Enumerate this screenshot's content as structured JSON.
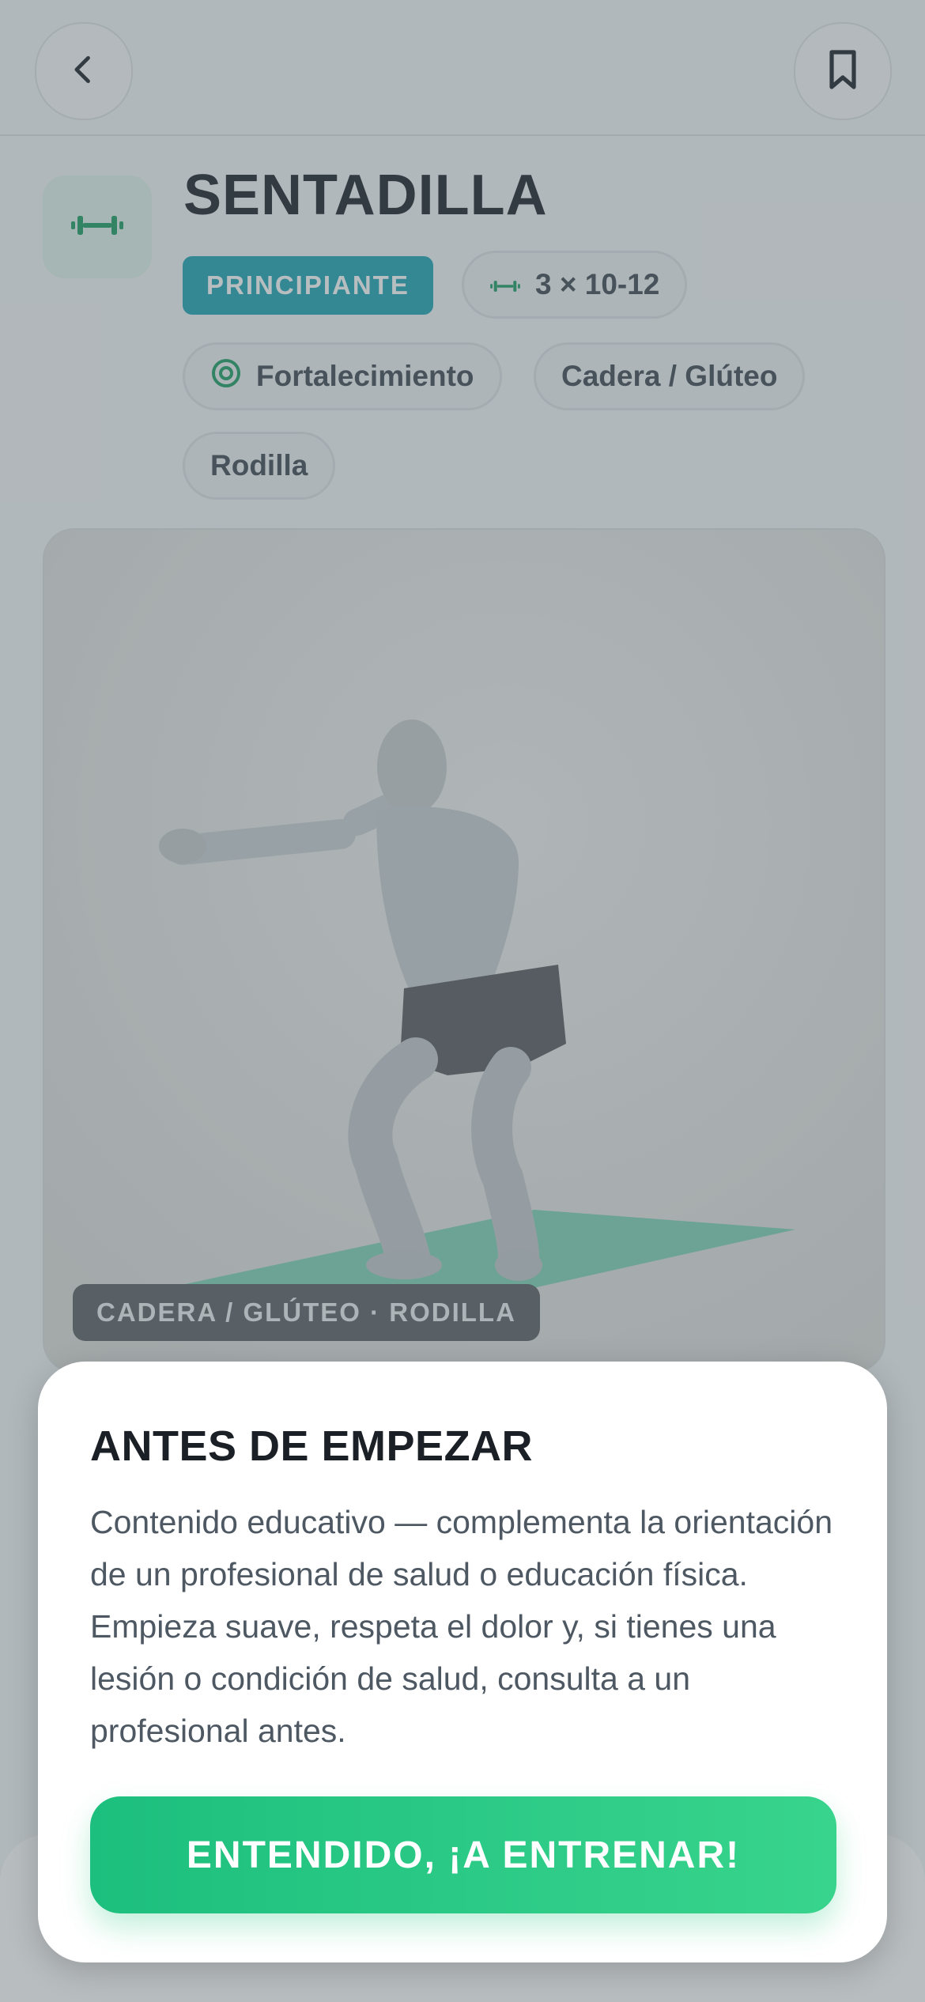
{
  "exercise": {
    "title": "SENTADILLA",
    "level": "PRINCIPIANTE",
    "prescription": "3 × 10-12",
    "tags": [
      "Fortalecimiento",
      "Cadera / Glúteo",
      "Rodilla"
    ],
    "media_label": "CADERA / GLÚTEO · RODILLA"
  },
  "colors": {
    "accent_green": "#1dbf7e",
    "level_teal": "#1ba4b4",
    "icon_green": "#1a9c63"
  },
  "icons": {
    "back": "chevron-left-icon",
    "bookmark": "bookmark-icon",
    "exercise": "dumbbell-icon",
    "goal": "target-icon"
  },
  "modal": {
    "title": "ANTES DE EMPEZAR",
    "body": "Contenido educativo — complementa la orientación de un profesional de salud o educación física. Empieza suave, respeta el dolor y, si tienes una lesión o condición de salud, consulta a un profesional antes.",
    "cta_label": "ENTENDIDO, ¡A ENTRENAR!"
  }
}
